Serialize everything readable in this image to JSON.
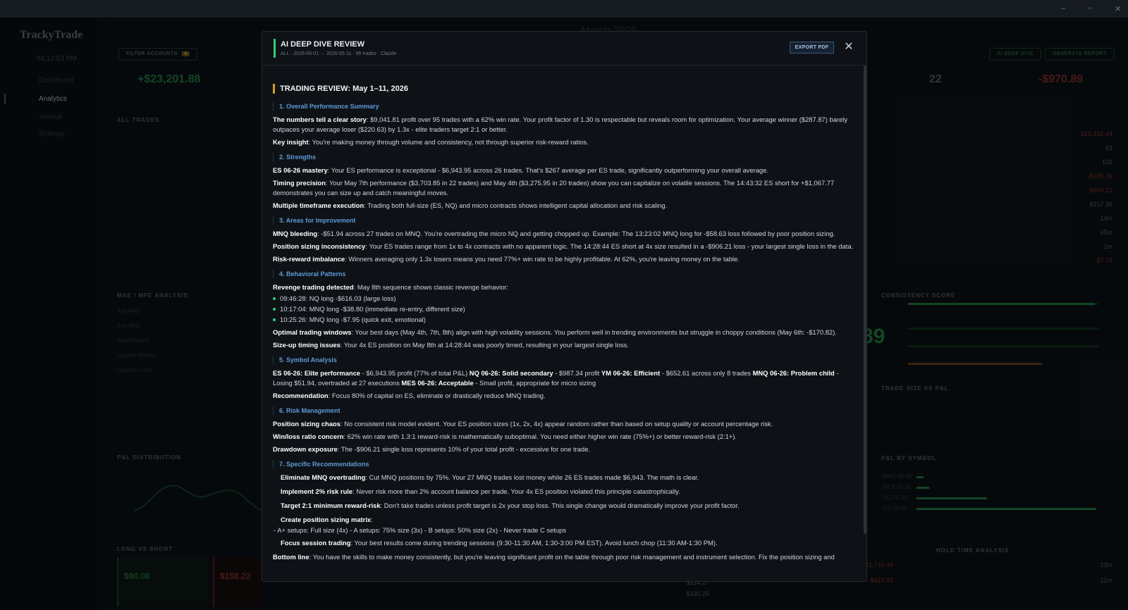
{
  "window": {
    "minimize": "–",
    "maximize": "▫",
    "close": "✕"
  },
  "app": {
    "logo": "TrackyTrade",
    "clock": "04:12:53 PM",
    "nav": [
      "Dashboard",
      "Analytics",
      "Journal",
      "Settings"
    ],
    "month": "March 2026",
    "filter_label": "FILTER ACCOUNTS",
    "filter_count": "4",
    "total_pnl": "+$23,201.88",
    "trades_count": "22",
    "neg_stat": "-$970.89",
    "ai_deep_dive_btn": "AI DEEP DIVE",
    "generate_report_btn": "GENERATE REPORT",
    "all_trades_title": "ALL TRADES",
    "mae_title": "MAE / MFE ANALYSIS",
    "mae_rows": [
      "Avg MAE",
      "Avg MFE",
      "Risk/Reward",
      "Largest Winner",
      "Largest Loser"
    ],
    "pnl_dist_title": "P&L DISTRIBUTION",
    "long_short_title": "LONG VS SHORT",
    "long_val": "$90.08",
    "short_val": "$158.22",
    "consistency_title": "CONSISTENCY SCORE",
    "consistency_score": "89",
    "trade_size_title": "TRADE SIZE VS P&L",
    "pnl_symbol_title": "P&L BY SYMBOL",
    "symbols": [
      "MNQ 06-26",
      "MES 06-26",
      "NQ 06-26",
      "ES 06-26"
    ],
    "hold_time_title": "HOLD TIME ANALYSIS",
    "right_values": [
      "$15,142.44",
      "63",
      "102",
      "-$180.36",
      "-$906.21",
      "$217.36",
      "14m",
      "45m",
      "1m",
      "-$7.74"
    ],
    "bottom_values": [
      "-$1,740.46",
      "-$615.93",
      "13m",
      "12m",
      "57",
      "$114.27",
      "$330.25"
    ]
  },
  "modal": {
    "title": "AI DEEP DIVE REVIEW",
    "subtitle": "ALL · 2026-05-01 → 2026-05-11 · 95 trades · Claude",
    "export_label": "EXPORT PDF",
    "close_icon": "✕",
    "report_title": "TRADING REVIEW: May 1–11, 2026",
    "sections": {
      "s1": "1. Overall Performance Summary",
      "s2": "2. Strengths",
      "s3": "3. Areas for Improvement",
      "s4": "4. Behavioral Patterns",
      "s5": "5. Symbol Analysis",
      "s6": "6. Risk Management",
      "s7": "7. Specific Recommendations"
    },
    "p1_b": "The numbers tell a clear story",
    "p1": ": $9,041.81 profit over 95 trades with a 62% win rate. Your profit factor of 1.30 is respectable but reveals room for optimization. Your average winner ($287.87) barely outpaces your average loser ($220.63) by 1.3x - elite traders target 2:1 or better.",
    "p2_b": "Key insight",
    "p2": ": You're making money through volume and consistency, not through superior risk-reward ratios.",
    "p3_b": "ES 06-26 mastery",
    "p3": ": Your ES performance is exceptional - $6,943.95 across 26 trades. That's $267 average per ES trade, significantly outperforming your overall average.",
    "p4_b": "Timing precision",
    "p4": ": Your May 7th performance ($3,703.85 in 22 trades) and May 4th ($3,275.95 in 20 trades) show you can capitalize on volatile sessions. The 14:43:32 ES short for +$1,067.77 demonstrates you can size up and catch meaningful moves.",
    "p5_b": "Multiple timeframe execution",
    "p5": ": Trading both full-size (ES, NQ) and micro contracts shows intelligent capital allocation and risk scaling.",
    "p6_b": "MNQ bleeding",
    "p6": ": -$51.94 across 27 trades on MNQ. You're overtrading the micro NQ and getting chopped up. Example: The 13:23:02 MNQ long for -$58.63 loss followed by poor position sizing.",
    "p7_b": "Position sizing inconsistency",
    "p7": ": Your ES trades range from 1x to 4x contracts with no apparent logic. The 14:28:44 ES short at 4x size resulted in a -$906.21 loss - your largest single loss in the data.",
    "p8_b": "Risk-reward imbalance",
    "p8": ": Winners averaging only 1.3x losers means you need 77%+ win rate to be highly profitable. At 62%, you're leaving money on the table.",
    "p9_b": "Revenge trading detected",
    "p9": ": May 8th sequence shows classic revenge behavior:",
    "bullets": [
      "09:46:28: NQ long -$616.03 (large loss)",
      "10:17:04: MNQ long -$38.80 (immediate re-entry, different size)",
      "10:25:26: MNQ long -$7.95 (quick exit, emotional)"
    ],
    "p10_b": "Optimal trading windows",
    "p10": ": Your best days (May 4th, 7th, 8th) align with high volatility sessions. You perform well in trending environments but struggle in choppy conditions (May 6th: -$170.82).",
    "p11_b": "Size-up timing issues",
    "p11": ": Your 4x ES position on May 8th at 14:28:44 was poorly timed, resulting in your largest single loss.",
    "p12_b1": "ES 06-26: Elite performance",
    "p12_t1": " - $6,943.95 profit (77% of total P&L) ",
    "p12_b2": "NQ 06-26: Solid secondary",
    "p12_t2": " - $987.34 profit ",
    "p12_b3": "YM 06-26: Efficient",
    "p12_t3": " - $652.61 across only 8 trades ",
    "p12_b4": "MNQ 06-26: Problem child",
    "p12_t4": " - Losing $51.94, overtraded at 27 executions ",
    "p12_b5": "MES 06-26: Acceptable",
    "p12_t5": " - Small profit, appropriate for micro sizing",
    "p13_b": "Recommendation",
    "p13": ": Focus 80% of capital on ES, eliminate or drastically reduce MNQ trading.",
    "p14_b": "Position sizing chaos",
    "p14": ": No consistent risk model evident. Your ES position sizes (1x, 2x, 4x) appear random rather than based on setup quality or account percentage risk.",
    "p15_b": "Win/loss ratio concern",
    "p15": ": 62% win rate with 1.3:1 reward-risk is mathematically suboptimal. You need either higher win rate (75%+) or better reward-risk (2:1+).",
    "p16_b": "Drawdown exposure",
    "p16": ": The -$906.21 single loss represents 10% of your total profit - excessive for one trade.",
    "r1_b": "Eliminate MNQ overtrading",
    "r1": ": Cut MNQ positions by 75%. Your 27 MNQ trades lost money while 26 ES trades made $6,943. The math is clear.",
    "r2_b": "Implement 2% risk rule",
    "r2": ": Never risk more than 2% account balance per trade. Your 4x ES position violated this principle catastrophically.",
    "r3_b": "Target 2:1 minimum reward-risk",
    "r3": ": Don't take trades unless profit target is 2x your stop loss. This single change would dramatically improve your profit factor.",
    "r4_b": "Create position sizing matrix",
    "r4": ":",
    "r4_line": "- A+ setups: Full size (4x) - A setups: 75% size (3x) - B setups: 50% size (2x) - Never trade C setups",
    "r5_b": "Focus session trading",
    "r5": ": Your best results come during trending sessions (9:30-11:30 AM, 1:30-3:00 PM EST). Avoid lunch chop (11:30 AM-1:30 PM).",
    "bl_b": "Bottom line",
    "bl": ": You have the skills to make money consistently, but you're leaving significant profit on the table through poor risk management and instrument selection. Fix the position sizing and"
  },
  "colors": {
    "accent_green": "#2fd07a",
    "accent_gold": "#d29b2a",
    "link_blue": "#5e9ad6",
    "loss_red": "#c2453f"
  }
}
